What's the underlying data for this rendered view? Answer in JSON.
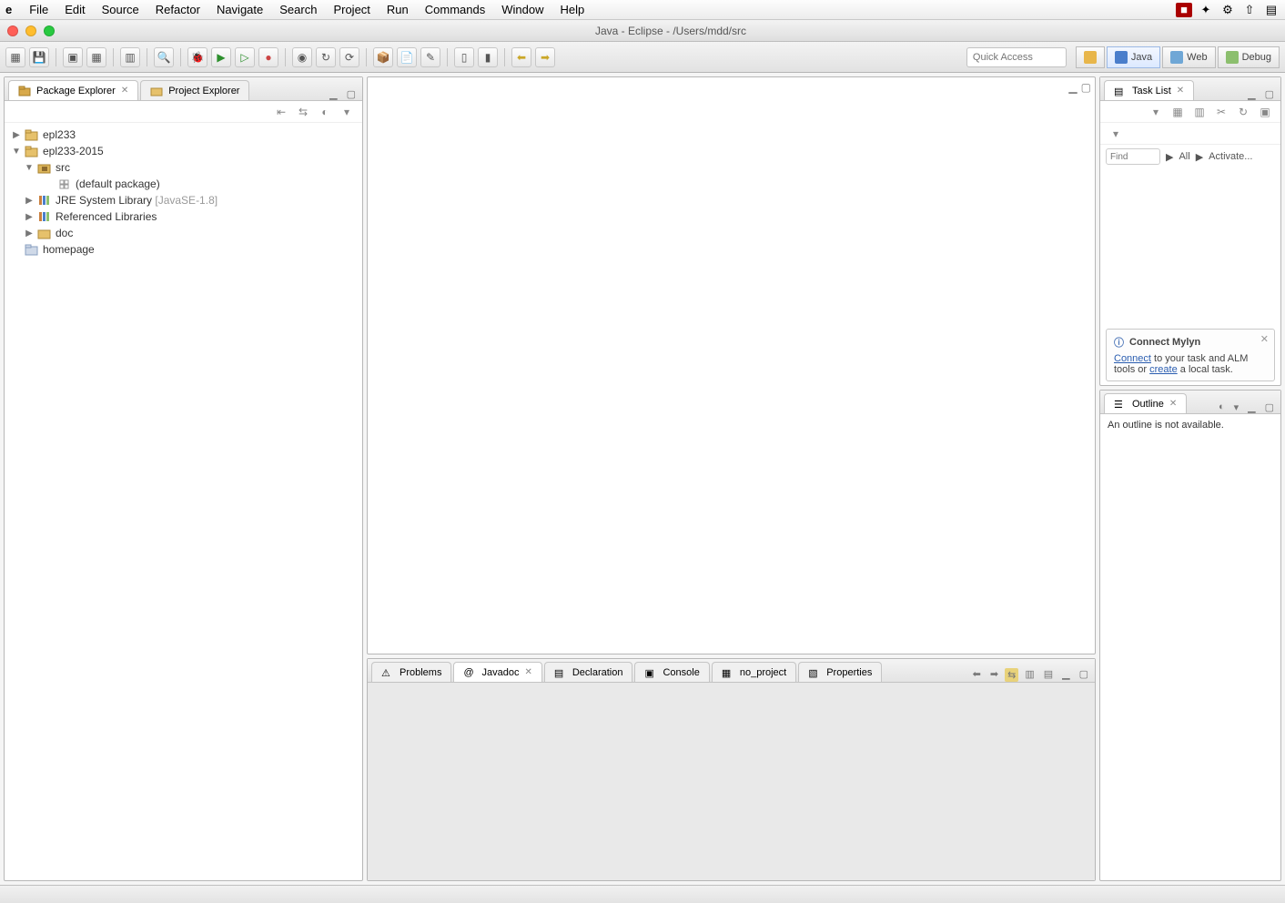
{
  "mac_menu": {
    "app": "e",
    "items": [
      "File",
      "Edit",
      "Source",
      "Refactor",
      "Navigate",
      "Search",
      "Project",
      "Run",
      "Commands",
      "Window",
      "Help"
    ]
  },
  "window_title": "Java - Eclipse - /Users/mdd/src",
  "quick_access_placeholder": "Quick Access",
  "perspectives": [
    {
      "label": "Java",
      "active": true
    },
    {
      "label": "Web",
      "active": false
    },
    {
      "label": "Debug",
      "active": false
    }
  ],
  "left_tabs": [
    {
      "label": "Package Explorer",
      "active": true
    },
    {
      "label": "Project Explorer",
      "active": false
    }
  ],
  "tree": {
    "projects": [
      {
        "name": "epl233",
        "expanded": false
      },
      {
        "name": "epl233-2015",
        "expanded": true,
        "children": [
          {
            "name": "src",
            "kind": "source-folder",
            "expanded": true,
            "children": [
              {
                "name": "(default package)",
                "kind": "package"
              }
            ]
          },
          {
            "name": "JRE System Library",
            "suffix": "[JavaSE-1.8]",
            "kind": "library",
            "expanded": false
          },
          {
            "name": "Referenced Libraries",
            "kind": "library",
            "expanded": false
          },
          {
            "name": "doc",
            "kind": "folder",
            "expanded": false
          }
        ]
      },
      {
        "name": "homepage",
        "kind": "project",
        "expanded": false
      }
    ]
  },
  "bottom_tabs": [
    {
      "label": "Problems",
      "active": false
    },
    {
      "label": "Javadoc",
      "active": true
    },
    {
      "label": "Declaration",
      "active": false
    },
    {
      "label": "Console",
      "active": false
    },
    {
      "label": "no_project",
      "active": false
    },
    {
      "label": "Properties",
      "active": false
    }
  ],
  "task_list": {
    "title": "Task List",
    "find_placeholder": "Find",
    "filters": {
      "all": "All",
      "activate": "Activate..."
    }
  },
  "mylyn": {
    "title": "Connect Mylyn",
    "connect": "Connect",
    "text_mid": " to your task and ALM tools or ",
    "create": "create",
    "text_end": " a local task."
  },
  "outline": {
    "title": "Outline",
    "empty": "An outline is not available."
  }
}
